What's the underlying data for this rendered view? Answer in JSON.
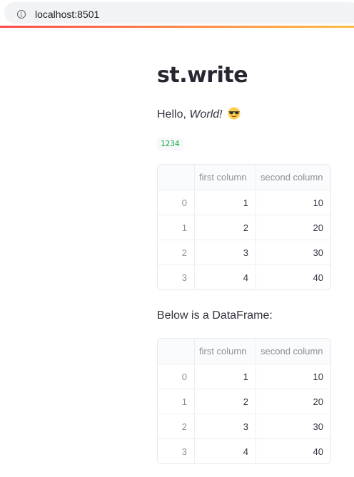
{
  "browser": {
    "url": "localhost:8501"
  },
  "page": {
    "title": "st.write",
    "hello_prefix": "Hello, ",
    "hello_italic": "World!",
    "emoji": "😎",
    "code_value": "1234",
    "below_text": "Below is a DataFrame:"
  },
  "table1": {
    "columns": [
      "",
      "first column",
      "second column"
    ],
    "rows": [
      [
        "0",
        "1",
        "10"
      ],
      [
        "1",
        "2",
        "20"
      ],
      [
        "2",
        "3",
        "30"
      ],
      [
        "3",
        "4",
        "40"
      ]
    ]
  },
  "table2": {
    "columns": [
      "",
      "first column",
      "second column"
    ],
    "rows": [
      [
        "0",
        "1",
        "10"
      ],
      [
        "1",
        "2",
        "20"
      ],
      [
        "2",
        "3",
        "30"
      ],
      [
        "3",
        "4",
        "40"
      ]
    ]
  }
}
